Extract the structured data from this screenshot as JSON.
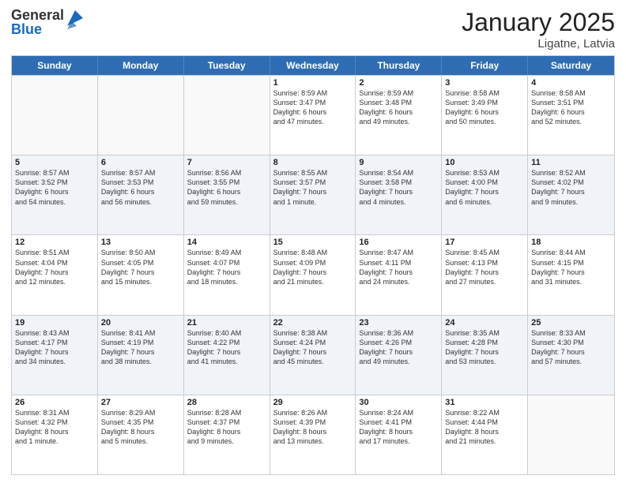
{
  "logo": {
    "general": "General",
    "blue": "Blue"
  },
  "header": {
    "month": "January 2025",
    "location": "Ligatne, Latvia"
  },
  "weekdays": [
    "Sunday",
    "Monday",
    "Tuesday",
    "Wednesday",
    "Thursday",
    "Friday",
    "Saturday"
  ],
  "rows": [
    [
      {
        "day": "",
        "lines": []
      },
      {
        "day": "",
        "lines": []
      },
      {
        "day": "",
        "lines": []
      },
      {
        "day": "1",
        "lines": [
          "Sunrise: 8:59 AM",
          "Sunset: 3:47 PM",
          "Daylight: 6 hours",
          "and 47 minutes."
        ]
      },
      {
        "day": "2",
        "lines": [
          "Sunrise: 8:59 AM",
          "Sunset: 3:48 PM",
          "Daylight: 6 hours",
          "and 49 minutes."
        ]
      },
      {
        "day": "3",
        "lines": [
          "Sunrise: 8:58 AM",
          "Sunset: 3:49 PM",
          "Daylight: 6 hours",
          "and 50 minutes."
        ]
      },
      {
        "day": "4",
        "lines": [
          "Sunrise: 8:58 AM",
          "Sunset: 3:51 PM",
          "Daylight: 6 hours",
          "and 52 minutes."
        ]
      }
    ],
    [
      {
        "day": "5",
        "lines": [
          "Sunrise: 8:57 AM",
          "Sunset: 3:52 PM",
          "Daylight: 6 hours",
          "and 54 minutes."
        ]
      },
      {
        "day": "6",
        "lines": [
          "Sunrise: 8:57 AM",
          "Sunset: 3:53 PM",
          "Daylight: 6 hours",
          "and 56 minutes."
        ]
      },
      {
        "day": "7",
        "lines": [
          "Sunrise: 8:56 AM",
          "Sunset: 3:55 PM",
          "Daylight: 6 hours",
          "and 59 minutes."
        ]
      },
      {
        "day": "8",
        "lines": [
          "Sunrise: 8:55 AM",
          "Sunset: 3:57 PM",
          "Daylight: 7 hours",
          "and 1 minute."
        ]
      },
      {
        "day": "9",
        "lines": [
          "Sunrise: 8:54 AM",
          "Sunset: 3:58 PM",
          "Daylight: 7 hours",
          "and 4 minutes."
        ]
      },
      {
        "day": "10",
        "lines": [
          "Sunrise: 8:53 AM",
          "Sunset: 4:00 PM",
          "Daylight: 7 hours",
          "and 6 minutes."
        ]
      },
      {
        "day": "11",
        "lines": [
          "Sunrise: 8:52 AM",
          "Sunset: 4:02 PM",
          "Daylight: 7 hours",
          "and 9 minutes."
        ]
      }
    ],
    [
      {
        "day": "12",
        "lines": [
          "Sunrise: 8:51 AM",
          "Sunset: 4:04 PM",
          "Daylight: 7 hours",
          "and 12 minutes."
        ]
      },
      {
        "day": "13",
        "lines": [
          "Sunrise: 8:50 AM",
          "Sunset: 4:05 PM",
          "Daylight: 7 hours",
          "and 15 minutes."
        ]
      },
      {
        "day": "14",
        "lines": [
          "Sunrise: 8:49 AM",
          "Sunset: 4:07 PM",
          "Daylight: 7 hours",
          "and 18 minutes."
        ]
      },
      {
        "day": "15",
        "lines": [
          "Sunrise: 8:48 AM",
          "Sunset: 4:09 PM",
          "Daylight: 7 hours",
          "and 21 minutes."
        ]
      },
      {
        "day": "16",
        "lines": [
          "Sunrise: 8:47 AM",
          "Sunset: 4:11 PM",
          "Daylight: 7 hours",
          "and 24 minutes."
        ]
      },
      {
        "day": "17",
        "lines": [
          "Sunrise: 8:45 AM",
          "Sunset: 4:13 PM",
          "Daylight: 7 hours",
          "and 27 minutes."
        ]
      },
      {
        "day": "18",
        "lines": [
          "Sunrise: 8:44 AM",
          "Sunset: 4:15 PM",
          "Daylight: 7 hours",
          "and 31 minutes."
        ]
      }
    ],
    [
      {
        "day": "19",
        "lines": [
          "Sunrise: 8:43 AM",
          "Sunset: 4:17 PM",
          "Daylight: 7 hours",
          "and 34 minutes."
        ]
      },
      {
        "day": "20",
        "lines": [
          "Sunrise: 8:41 AM",
          "Sunset: 4:19 PM",
          "Daylight: 7 hours",
          "and 38 minutes."
        ]
      },
      {
        "day": "21",
        "lines": [
          "Sunrise: 8:40 AM",
          "Sunset: 4:22 PM",
          "Daylight: 7 hours",
          "and 41 minutes."
        ]
      },
      {
        "day": "22",
        "lines": [
          "Sunrise: 8:38 AM",
          "Sunset: 4:24 PM",
          "Daylight: 7 hours",
          "and 45 minutes."
        ]
      },
      {
        "day": "23",
        "lines": [
          "Sunrise: 8:36 AM",
          "Sunset: 4:26 PM",
          "Daylight: 7 hours",
          "and 49 minutes."
        ]
      },
      {
        "day": "24",
        "lines": [
          "Sunrise: 8:35 AM",
          "Sunset: 4:28 PM",
          "Daylight: 7 hours",
          "and 53 minutes."
        ]
      },
      {
        "day": "25",
        "lines": [
          "Sunrise: 8:33 AM",
          "Sunset: 4:30 PM",
          "Daylight: 7 hours",
          "and 57 minutes."
        ]
      }
    ],
    [
      {
        "day": "26",
        "lines": [
          "Sunrise: 8:31 AM",
          "Sunset: 4:32 PM",
          "Daylight: 8 hours",
          "and 1 minute."
        ]
      },
      {
        "day": "27",
        "lines": [
          "Sunrise: 8:29 AM",
          "Sunset: 4:35 PM",
          "Daylight: 8 hours",
          "and 5 minutes."
        ]
      },
      {
        "day": "28",
        "lines": [
          "Sunrise: 8:28 AM",
          "Sunset: 4:37 PM",
          "Daylight: 8 hours",
          "and 9 minutes."
        ]
      },
      {
        "day": "29",
        "lines": [
          "Sunrise: 8:26 AM",
          "Sunset: 4:39 PM",
          "Daylight: 8 hours",
          "and 13 minutes."
        ]
      },
      {
        "day": "30",
        "lines": [
          "Sunrise: 8:24 AM",
          "Sunset: 4:41 PM",
          "Daylight: 8 hours",
          "and 17 minutes."
        ]
      },
      {
        "day": "31",
        "lines": [
          "Sunrise: 8:22 AM",
          "Sunset: 4:44 PM",
          "Daylight: 8 hours",
          "and 21 minutes."
        ]
      },
      {
        "day": "",
        "lines": []
      }
    ]
  ]
}
